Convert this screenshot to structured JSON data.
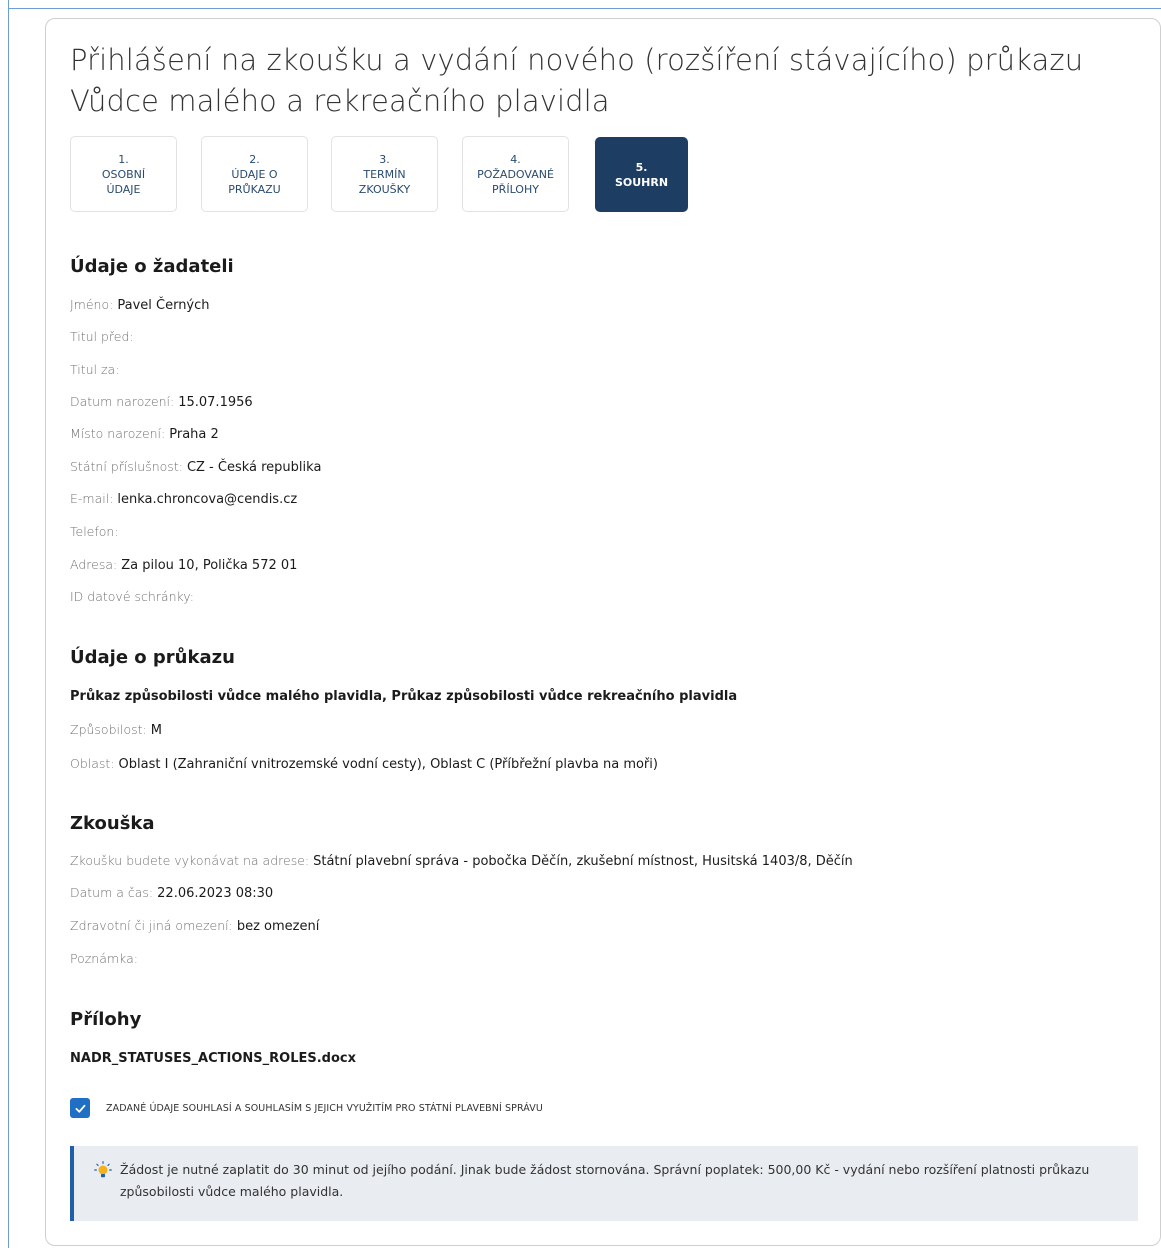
{
  "page": {
    "title": "Přihlášení na zkoušku a vydání nového (rozšíření stávajícího) průkazu Vůdce malého a rekreačního plavidla"
  },
  "steps": [
    {
      "number": "1.",
      "label": "OSOBNÍ\nÚDAJE"
    },
    {
      "number": "2.",
      "label": "ÚDAJE O\nPRŮKAZU"
    },
    {
      "number": "3.",
      "label": "TERMÍN\nZKOUŠKY"
    },
    {
      "number": "4.",
      "label": "POŽADOVANÉ\nPŘÍLOHY"
    },
    {
      "number": "5.",
      "label": "SOUHRN",
      "active": true
    }
  ],
  "applicant": {
    "heading": "Údaje o žadateli",
    "fields": [
      {
        "label": "Jméno:",
        "value": "Pavel Černých"
      },
      {
        "label": "Titul před:",
        "value": ""
      },
      {
        "label": "Titul za:",
        "value": ""
      },
      {
        "label": "Datum narození:",
        "value": "15.07.1956"
      },
      {
        "label": "Místo narození:",
        "value": "Praha 2"
      },
      {
        "label": "Státní příslušnost:",
        "value": "CZ - Česká republika"
      },
      {
        "label": "E-mail:",
        "value": "lenka.chroncova@cendis.cz"
      },
      {
        "label": "Telefon:",
        "value": ""
      },
      {
        "label": "Adresa:",
        "value": "Za pilou 10, Polička 572 01"
      },
      {
        "label": "ID datové schránky:",
        "value": ""
      }
    ]
  },
  "license": {
    "heading": "Údaje o průkazu",
    "title": "Průkaz způsobilosti vůdce malého plavidla, Průkaz způsobilosti vůdce rekreačního plavidla",
    "fields": [
      {
        "label": "Způsobilost:",
        "value": "M"
      },
      {
        "label": "Oblast:",
        "value": "Oblast I (Zahraniční vnitrozemské vodní cesty), Oblast C (Příbřežní plavba na moři)"
      }
    ]
  },
  "exam": {
    "heading": "Zkouška",
    "fields": [
      {
        "label": "Zkoušku budete vykonávat na adrese:",
        "value": "Státní plavební správa - pobočka Děčín, zkušební místnost, Husitská 1403/8, Děčín"
      },
      {
        "label": "Datum a čas:",
        "value": "22.06.2023 08:30"
      },
      {
        "label": "Zdravotní či jiná omezení:",
        "value": "bez omezení"
      },
      {
        "label": "Poznámka:",
        "value": ""
      }
    ]
  },
  "attachments": {
    "heading": "Přílohy",
    "file": "NADR_STATUSES_ACTIONS_ROLES.docx"
  },
  "consent": {
    "checked": true,
    "label": "ZADANÉ ÚDAJE SOUHLASÍ A SOUHLASÍM S JEJICH VYUŽITÍM PRO STÁTNÍ PLAVEBNÍ SPRÁVU"
  },
  "info": {
    "icon": "lightbulb-icon",
    "text": "Žádost je nutné zaplatit do 30 minut od jejího podání. Jinak bude žádost stornována. Správní poplatek: 500,00 Kč - vydání nebo rozšíření platnosti průkazu způsobilosti vůdce malého plavidla."
  },
  "colors": {
    "active_step": "#1e3d63",
    "checkbox": "#1f6fc5",
    "info_border": "#1f5ea8",
    "info_bg": "#e9ecf1"
  }
}
